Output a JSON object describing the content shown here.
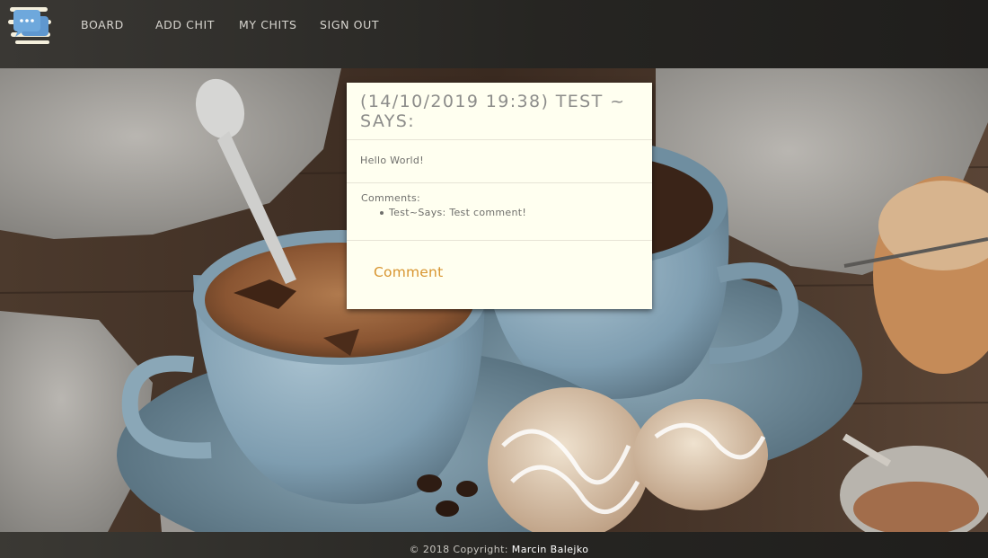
{
  "nav": {
    "logo_icon": "chat-bubble-logo-icon",
    "links": [
      {
        "label": "BOARD"
      },
      {
        "label": "ADD CHIT"
      },
      {
        "label": "MY CHITS"
      },
      {
        "label": "SIGN OUT"
      }
    ]
  },
  "background": {
    "description_icon": "coffee-cups-background-image"
  },
  "chit": {
    "title": "(14/10/2019 19:38) TEST ~ SAYS:",
    "message": "Hello World!",
    "comments_label": "Comments:",
    "comments": [
      "Test~Says: Test comment!"
    ],
    "comment_button": "Comment"
  },
  "footer": {
    "copyright": "© 2018 Copyright:",
    "author": "Marcin Balejko"
  },
  "colors": {
    "accent": "#d89530",
    "card_background": "#fffff0",
    "header_background": "#262522"
  }
}
